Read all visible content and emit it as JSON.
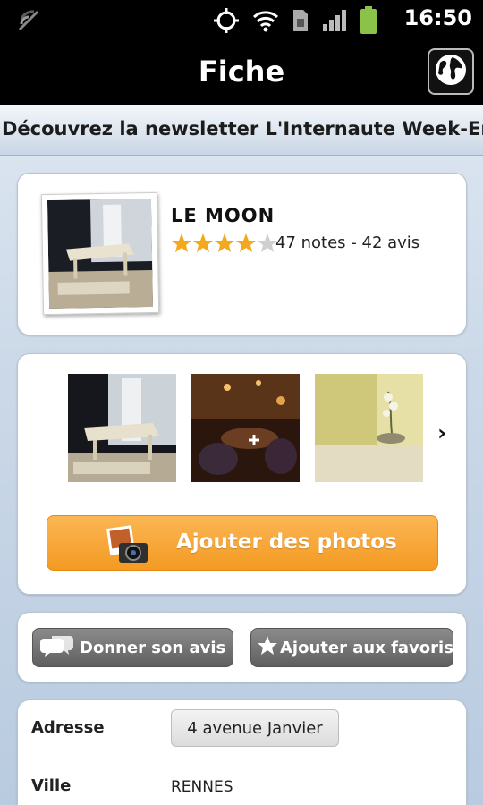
{
  "status_bar": {
    "time": "16:50",
    "icons": [
      "signal-strength-icon",
      "gps-icon",
      "wifi-icon",
      "sim-icon",
      "cell-signal-icon",
      "battery-icon"
    ],
    "battery_color": "#8bc34a"
  },
  "header": {
    "title": "Fiche",
    "globe_icon": "globe-icon"
  },
  "banner": {
    "text": "Découvrez la newsletter L'Internaute Week-End"
  },
  "venue": {
    "name": "LE MOON",
    "rating": 4,
    "rating_max": 5,
    "ratings_text": "47 notes - 42 avis",
    "star_color": "#f2a91e"
  },
  "gallery": {
    "next_glyph": "›",
    "add_photos_label": "Ajouter des photos",
    "accent": "#f6a02d"
  },
  "actions": {
    "review_label": "Donner son avis",
    "favorite_label": "Ajouter aux favoris"
  },
  "info": {
    "rows": [
      {
        "label": "Adresse",
        "value": "4 avenue Janvier"
      },
      {
        "label": "Ville",
        "value": "RENNES"
      }
    ]
  }
}
